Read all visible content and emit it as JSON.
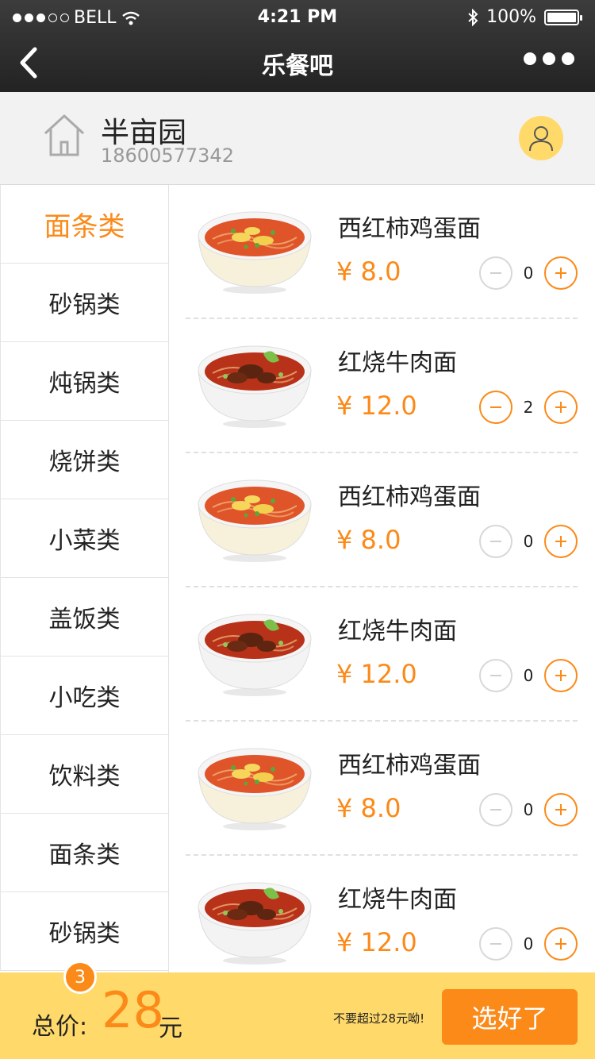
{
  "status_bar": {
    "carrier": "BELL",
    "time": "4:21 PM",
    "battery": "100%"
  },
  "nav": {
    "title": "乐餐吧"
  },
  "store": {
    "name": "半亩园",
    "phone": "18600577342"
  },
  "categories": [
    {
      "label": "面条类",
      "active": true
    },
    {
      "label": "砂锅类"
    },
    {
      "label": "炖锅类"
    },
    {
      "label": "烧饼类"
    },
    {
      "label": "小菜类"
    },
    {
      "label": "盖饭类"
    },
    {
      "label": "小吃类"
    },
    {
      "label": "饮料类"
    },
    {
      "label": "面条类"
    },
    {
      "label": "砂锅类"
    }
  ],
  "items": [
    {
      "name": "西红柿鸡蛋面",
      "price": "¥ 8.0",
      "qty": "0",
      "image": "tomato-egg-noodle-icon"
    },
    {
      "name": "红烧牛肉面",
      "price": "¥ 12.0",
      "qty": "2",
      "image": "braised-beef-noodle-icon"
    },
    {
      "name": "西红柿鸡蛋面",
      "price": "¥ 8.0",
      "qty": "0",
      "image": "tomato-egg-noodle-icon"
    },
    {
      "name": "红烧牛肉面",
      "price": "¥ 12.0",
      "qty": "0",
      "image": "braised-beef-noodle-icon"
    },
    {
      "name": "西红柿鸡蛋面",
      "price": "¥ 8.0",
      "qty": "0",
      "image": "tomato-egg-noodle-icon"
    },
    {
      "name": "红烧牛肉面",
      "price": "¥ 12.0",
      "qty": "0",
      "image": "braised-beef-noodle-icon"
    }
  ],
  "cart": {
    "count": "3",
    "total_label": "总价:",
    "total_value": "28",
    "total_unit": "元",
    "note": "不要超过28元呦!",
    "submit_label": "选好了"
  },
  "colors": {
    "accent": "#fb8a19",
    "bottom_bar": "#ffd96a",
    "nav_bg": "#2c2c2c"
  }
}
